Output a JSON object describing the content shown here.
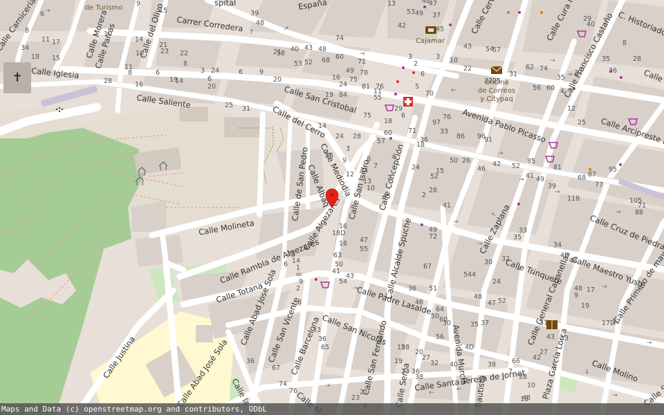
{
  "map": {
    "streets": [
      "Calle Carnicería",
      "Calle Morera",
      "Calle Parras",
      "Calle del Olivo",
      "Carrer Corredera",
      "Calle Iglesia",
      "Calle Saliente",
      "Calle San Cristobal",
      "Calle del Cerro",
      "Calle de San Pedro",
      "Calle Albaq",
      "Calle Mediodía",
      "Calle San Isidro",
      "Calle Concepción",
      "Calle Molineta",
      "Calle Algezares",
      "Calle Rambla de Algezares",
      "Calle Totana",
      "Calle Abad Jose Sola",
      "Calle San Vicente",
      "Calle Barcelona",
      "Calle San Nicolás",
      "Calle San Fernando",
      "Calle Alcalde Spuche",
      "Calle Padre Lasalde",
      "Avenida Murcia",
      "Calle Santa Teresa de Jornet",
      "Calle Justina",
      "Calle Abad José Sola",
      "Calle la Un",
      "Calle M",
      "Avenida Pablo Picasso",
      "Calle Francisco Castaño",
      "Calle Arcipreste Este",
      "Calle Cruz de Piedra",
      "Calle Zaplana",
      "Calle Trinquete",
      "Calle Maestro Yuste",
      "Calle General Cabanellas",
      "Calle Primero de mayo",
      "Calle Molino",
      "Calle Cura Ib",
      "C. Historiador Ma",
      "Calle Maest",
      "Calle Cervante",
      "España",
      "spital",
      "Plaza García Lorca",
      "Calle Serna",
      "Bautista",
      "Calle Sar"
    ],
    "pois": {
      "turismo": "de Turismo",
      "bank": "Cajamar",
      "post_office": "Oficina de Correos y Citypaq"
    },
    "house_numbers": [
      "9",
      "15",
      "6",
      "34",
      "39",
      "48",
      "8",
      "11",
      "17",
      "15",
      "18",
      "10",
      "14",
      "10",
      "21",
      "23",
      "22",
      "8",
      "6",
      "8",
      "16",
      "11",
      "19",
      "14",
      "6",
      "20",
      "28",
      "25",
      "31",
      "3",
      "24",
      "6",
      "9",
      "20",
      "21",
      "40",
      "43",
      "48",
      "58",
      "53",
      "52",
      "68",
      "60",
      "74",
      "78",
      "71",
      "49",
      "75",
      "81",
      "76",
      "84",
      "55",
      "75",
      "28",
      "24",
      "26",
      "3",
      "9",
      "12",
      "14",
      "19",
      "16",
      "24",
      "13",
      "53",
      "49",
      "47",
      "37",
      "45",
      "42",
      "3",
      "2",
      "6",
      "5",
      "11",
      "29",
      "18",
      "6",
      "3",
      "10",
      "22",
      "32",
      "25",
      "31",
      "62",
      "74",
      "56",
      "60",
      "4",
      "12",
      "25",
      "8",
      "28",
      "35",
      "37",
      "35",
      "36",
      "29",
      "40",
      "48",
      "43",
      "54",
      "57",
      "71",
      "36",
      "33",
      "26",
      "46",
      "42",
      "52",
      "41",
      "49",
      "39",
      "118",
      "87",
      "95",
      "105",
      "88",
      "71",
      "77",
      "68",
      "81",
      "85",
      "91",
      "96",
      "86",
      "97",
      "76",
      "70",
      "60",
      "57",
      "50",
      "52",
      "2",
      "4",
      "2",
      "8",
      "7",
      "18",
      "24",
      "15",
      "41",
      "28",
      "16",
      "18D",
      "16",
      "47",
      "10",
      "13",
      "44",
      "45",
      "55",
      "63",
      "50",
      "54",
      "41",
      "43",
      "49",
      "72",
      "67",
      "51",
      "64",
      "60",
      "544",
      "48",
      "47",
      "52",
      "24",
      "30",
      "32",
      "33",
      "35",
      "34",
      "40",
      "44",
      "48",
      "9",
      "17",
      "17D",
      "22",
      "19",
      "31",
      "43",
      "33",
      "36",
      "46",
      "50",
      "56",
      "58",
      "20",
      "12",
      "19",
      "23",
      "27",
      "32",
      "36",
      "38",
      "40",
      "4D",
      "30",
      "35",
      "7",
      "66",
      "28",
      "10",
      "18",
      "37",
      "38",
      "48",
      "42",
      "27",
      "15",
      "14",
      "1",
      "9",
      "2",
      "6",
      "8",
      "33",
      "36",
      "65",
      "67",
      "74",
      "76",
      "36",
      "21",
      "6",
      "23"
    ]
  },
  "attribution": "Maps and Data (c) openstreetmap.org and contributors, ODbL",
  "colors": {
    "land": "#e8e0d8",
    "block": "#d9d0c9",
    "park": "#a6cc96",
    "grass": "#cde8c0",
    "plaza": "#fff8d0",
    "marker": "#e2231a"
  }
}
